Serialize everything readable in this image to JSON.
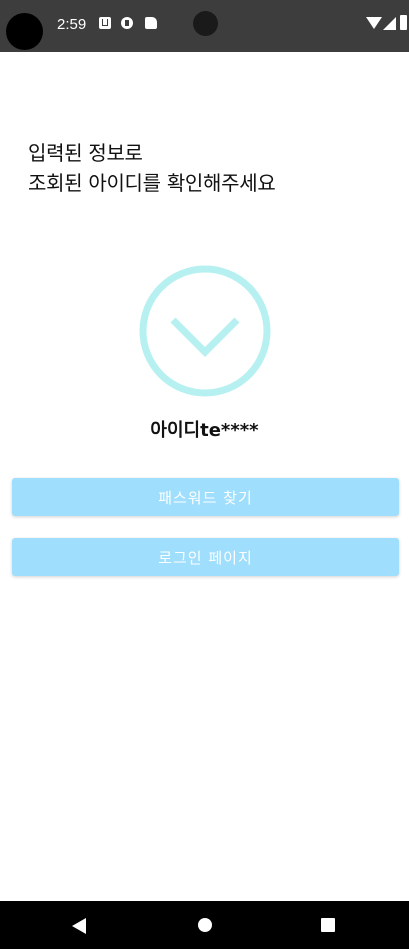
{
  "status_bar": {
    "time": "2:59",
    "icons": [
      "camera-cutout",
      "notification-a-icon",
      "notification-p-icon",
      "sd-card-icon",
      "wifi-icon",
      "signal-icon",
      "battery-icon"
    ]
  },
  "main": {
    "heading_line1": "입력된 정보로",
    "heading_line2": "조회된 아이디를 확인해주세요",
    "result_label": "아이디",
    "result_value": "te****",
    "icon": "check-circle-icon",
    "accent_color": "#b6f0f0"
  },
  "buttons": {
    "find_password": "패스워드 찾기",
    "login_page": "로그인 페이지",
    "color": "#9fdefc"
  },
  "nav_bar": {
    "icons": [
      "back-icon",
      "home-icon",
      "recents-icon"
    ]
  }
}
